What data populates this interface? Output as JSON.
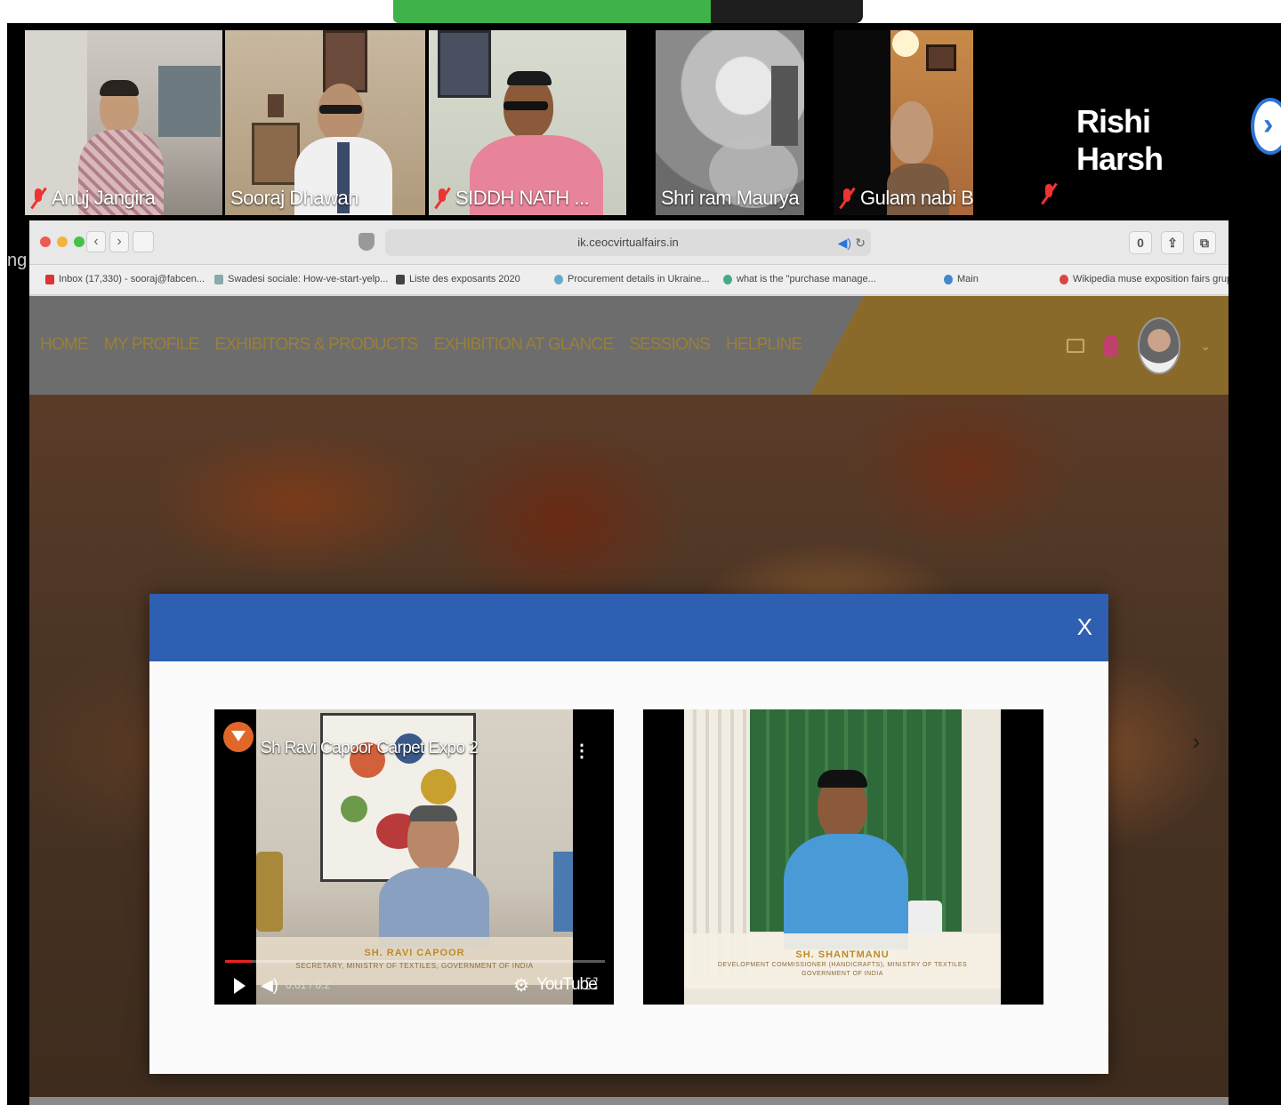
{
  "zoom": {
    "participants": [
      {
        "name": "Anuj Jangira",
        "muted": true,
        "active": false
      },
      {
        "name": "Sooraj Dhawan",
        "muted": false,
        "active": true
      },
      {
        "name": "SIDDH NATH ...",
        "muted": true,
        "active": false
      },
      {
        "name": "Shri ram Maurya",
        "muted": false,
        "active": false
      },
      {
        "name": "Gulam nabi B...",
        "muted": true,
        "active": false
      }
    ],
    "featured_name": "Rishi Harsh",
    "left_clip_text": "ng"
  },
  "browser": {
    "url": "ik.ceocvirtualfairs.in",
    "toolbar_count": "0",
    "bookmarks": [
      "Inbox (17,330) - sooraj@fabcen...",
      "Swadesi sociale: How-ve-start-yelp...",
      "Liste des exposants 2020",
      "Procurement details in Ukraine...",
      "what is the \"purchase manage...",
      "Main",
      "Wikipedia muse exposition fairs grupo..."
    ]
  },
  "site": {
    "menu": [
      "HOME",
      "MY PROFILE",
      "EXHIBITORS & PRODUCTS",
      "EXHIBITION AT GLANCE",
      "SESSIONS",
      "HELPLINE"
    ]
  },
  "modal": {
    "close_label": "X",
    "video1": {
      "title": "Sh Ravi Capoor Carpet Expo 2",
      "lower_third_name": "SH. RAVI CAPOOR",
      "lower_third_role": "SECRETARY, MINISTRY OF TEXTILES, GOVERNMENT OF INDIA",
      "time": "0:01 / 0:2",
      "progress": 0.07,
      "brand": "YouTube"
    },
    "video2": {
      "lower_third_name": "SH. SHANTMANU",
      "lower_third_role": "DEVELOPMENT COMMISSIONER (HANDICRAFTS), MINISTRY OF TEXTILES",
      "lower_third_org": "GOVERNMENT OF INDIA"
    }
  },
  "colors": {
    "modal_header": "#2e5fb0",
    "zoom_active": "#4ec94a",
    "share_banner": "#3fb24a",
    "nav_gold": "#8a6a2a"
  }
}
